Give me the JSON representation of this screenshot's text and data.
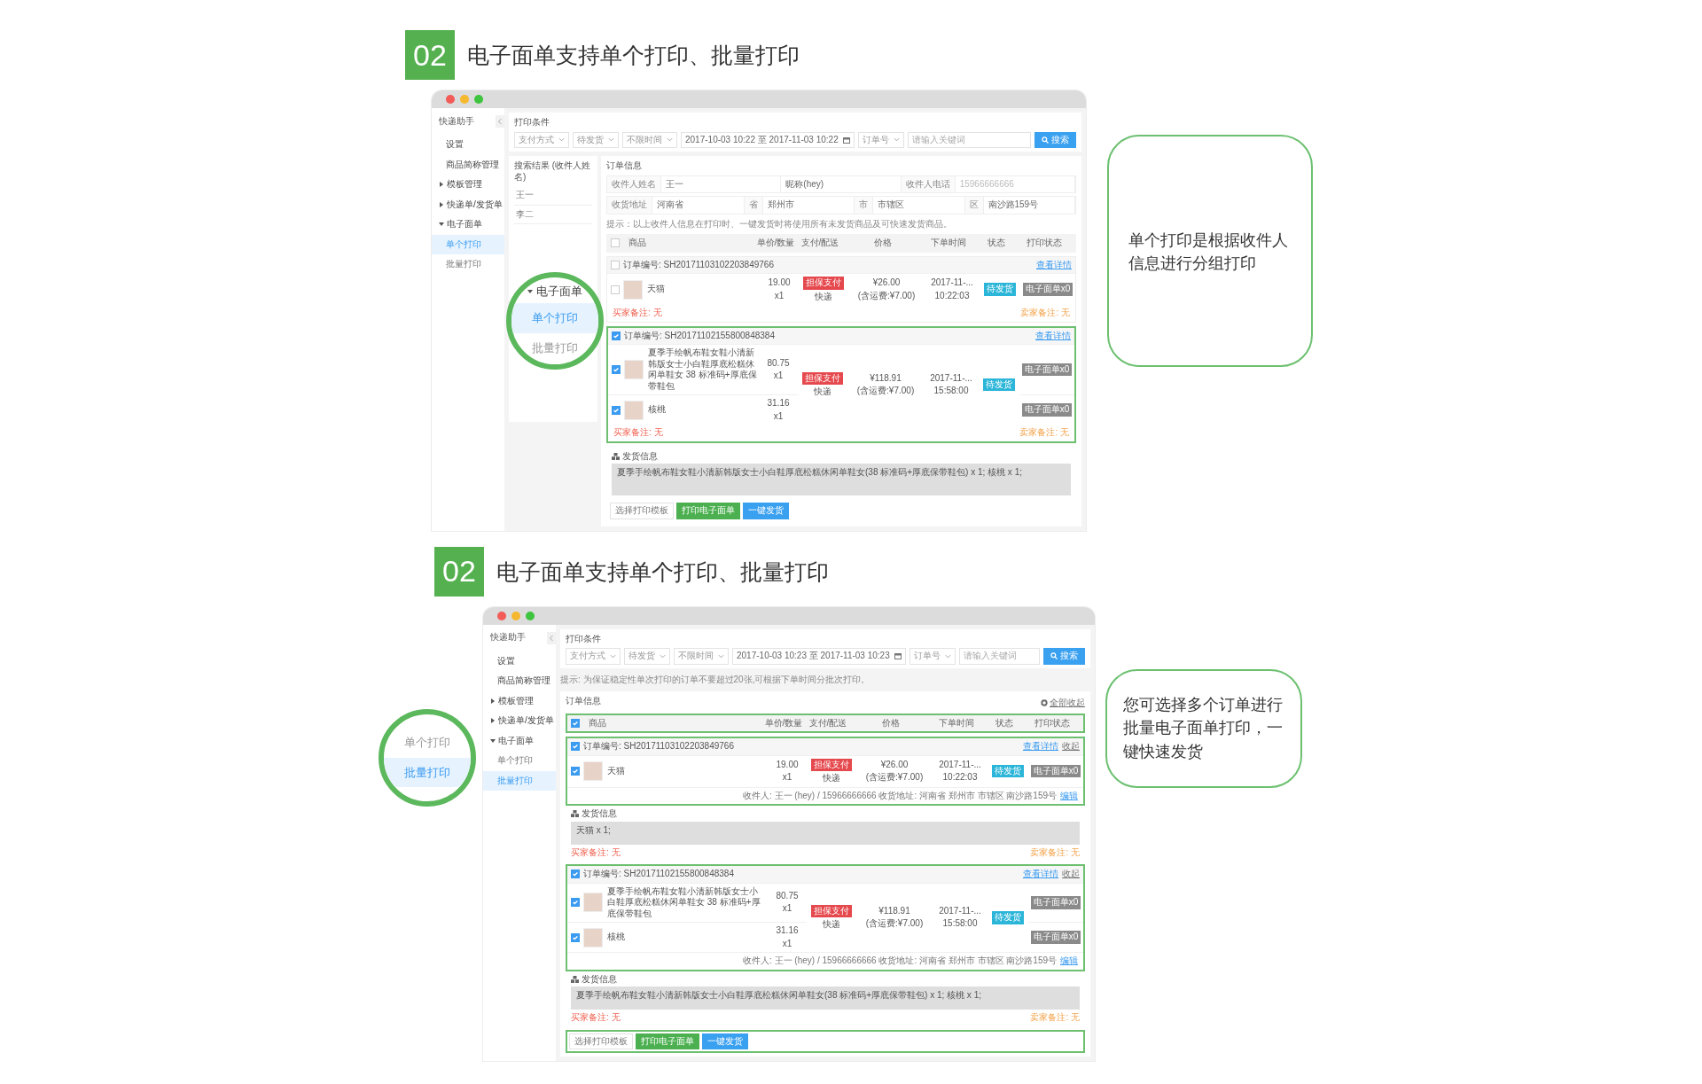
{
  "sections": [
    {
      "badge": "02",
      "title": "电子面单支持单个打印、批量打印",
      "callout": "单个打印是根据收件人信息进行分组打印",
      "zoom_circle": {
        "heading": "电子面单",
        "items": [
          {
            "label": "单个打印",
            "selected": true
          },
          {
            "label": "批量打印",
            "selected": false
          }
        ]
      },
      "app": {
        "sidebar": {
          "title": "快递助手",
          "items": [
            {
              "label": "设置",
              "kind": "link",
              "selected": false
            },
            {
              "label": "商品简称管理",
              "kind": "link",
              "selected": false
            },
            {
              "label": "模板管理",
              "kind": "group",
              "expanded": false
            },
            {
              "label": "快递单/发货单",
              "kind": "group",
              "expanded": false
            },
            {
              "label": "电子面单",
              "kind": "group",
              "expanded": true,
              "children": [
                {
                  "label": "单个打印",
                  "selected": true
                },
                {
                  "label": "批量打印",
                  "selected": false
                }
              ]
            }
          ]
        },
        "filter": {
          "title": "打印条件",
          "selects": [
            "支付方式",
            "待发货",
            "不限时间"
          ],
          "date_range": "2017-10-03 10:22 至 2017-11-03 10:22",
          "order_select": "订单号",
          "search_placeholder": "请输入关键词",
          "search_button": "搜索"
        },
        "results": {
          "title": "搜索结果 (收件人姓名)",
          "items": [
            "王一",
            "李二"
          ]
        },
        "order_info": {
          "title": "订单信息"
        },
        "recipient_form": [
          [
            {
              "kind": "label",
              "text": "收件人姓名"
            },
            {
              "kind": "value",
              "text": "王一"
            },
            {
              "kind": "value",
              "text": "昵称(hey)"
            },
            {
              "kind": "label",
              "text": "收件人电话"
            },
            {
              "kind": "hint",
              "text": "15966666666"
            }
          ],
          [
            {
              "kind": "label",
              "text": "收货地址"
            },
            {
              "kind": "value",
              "text": "河南省"
            },
            {
              "kind": "label",
              "text": "省"
            },
            {
              "kind": "value",
              "text": "郑州市"
            },
            {
              "kind": "label",
              "text": "市"
            },
            {
              "kind": "value",
              "text": "市辖区"
            },
            {
              "kind": "label",
              "text": "区"
            },
            {
              "kind": "value",
              "text": "南沙路159号"
            }
          ]
        ],
        "hint": "提示：以上收件人信息在打印时、一键发货时将使用所有未发货商品及可快速发货商品。",
        "table_header": {
          "checked": false,
          "highlighted": false,
          "columns": [
            "商品",
            "单价/数量",
            "支付/配送",
            "价格",
            "下单时间",
            "状态",
            "打印状态"
          ]
        },
        "orders": [
          {
            "checked": false,
            "highlighted": false,
            "number": "订单编号: SH20171103102203849766",
            "detail_link": "查看详情",
            "payment": "担保支付",
            "shipping": "快递",
            "total": "¥26.00",
            "freight": "(含运费:¥7.00)",
            "date": "2017-11-...",
            "time": "10:22:03",
            "status": "待发货",
            "buyer_note": "买家备注: 无",
            "seller_note": "卖家备注: 无",
            "items": [
              {
                "checked": false,
                "name": "天猫",
                "price": "19.00",
                "qty": "x1",
                "print_status": "电子面单x0"
              }
            ]
          },
          {
            "checked": true,
            "highlighted": true,
            "number": "订单编号: SH20171102155800848384",
            "detail_link": "查看详情",
            "payment": "担保支付",
            "shipping": "快递",
            "total": "¥118.91",
            "freight": "(含运费:¥7.00)",
            "date": "2017-11-...",
            "time": "15:58:00",
            "status": "待发货",
            "buyer_note": "买家备注: 无",
            "seller_note": "卖家备注: 无",
            "items": [
              {
                "checked": true,
                "name": "夏季手绘帆布鞋女鞋小清新韩版女士小白鞋厚底松糕休闲单鞋女 38 标准码+厚底保带鞋包",
                "price": "80.75",
                "qty": "x1",
                "print_status": "电子面单x0"
              },
              {
                "checked": true,
                "name": "核桃",
                "price": "31.16",
                "qty": "x1",
                "print_status": "电子面单x0"
              }
            ]
          }
        ],
        "shipping_info": {
          "title": "发货信息",
          "text": "夏季手绘帆布鞋女鞋小清新韩版女士小白鞋厚底松糕休闲单鞋女(38 标准码+厚底保带鞋包) x 1; 核桃 x 1;"
        },
        "actions": {
          "highlighted": false,
          "template_label": "选择打印模板",
          "print_button": "打印电子面单",
          "ship_button": "一键发货"
        }
      }
    },
    {
      "badge": "02",
      "title": "电子面单支持单个打印、批量打印",
      "callout": "您可选择多个订单进行批量电子面单打印，一键快速发货",
      "zoom_circle": {
        "items": [
          {
            "label": "单个打印",
            "selected": false
          },
          {
            "label": "批量打印",
            "selected": true
          }
        ]
      },
      "app": {
        "sidebar": {
          "title": "快递助手",
          "items": [
            {
              "label": "设置",
              "kind": "link",
              "selected": false
            },
            {
              "label": "商品简称管理",
              "kind": "link",
              "selected": false
            },
            {
              "label": "模板管理",
              "kind": "group",
              "expanded": false
            },
            {
              "label": "快递单/发货单",
              "kind": "group",
              "expanded": false
            },
            {
              "label": "电子面单",
              "kind": "group",
              "expanded": true,
              "children": [
                {
                  "label": "单个打印",
                  "selected": false
                },
                {
                  "label": "批量打印",
                  "selected": true
                }
              ]
            }
          ]
        },
        "filter": {
          "title": "打印条件",
          "selects": [
            "支付方式",
            "待发货",
            "不限时间"
          ],
          "date_range": "2017-10-03 10:23 至 2017-11-03 10:23",
          "order_select": "订单号",
          "search_placeholder": "请输入关键词",
          "search_button": "搜索"
        },
        "hint": "提示: 为保证稳定性单次打印的订单不要超过20张,可根据下单时间分批次打印。",
        "order_info": {
          "title": "订单信息",
          "collapse_all": "全部收起"
        },
        "table_header": {
          "checked": true,
          "highlighted": true,
          "columns": [
            "商品",
            "单价/数量",
            "支付/配送",
            "价格",
            "下单时间",
            "状态",
            "打印状态"
          ]
        },
        "orders": [
          {
            "checked": true,
            "highlighted": true,
            "number": "订单编号: SH20171103102203849766",
            "detail_link": "查看详情",
            "collapse_link": "收起",
            "payment": "担保支付",
            "shipping": "快递",
            "total": "¥26.00",
            "freight": "(含运费:¥7.00)",
            "date": "2017-11-...",
            "time": "10:22:03",
            "status": "待发货",
            "recipient": "收件人: 王一 (hey) / 15966666666 收货地址: 河南省 郑州市 市辖区 南沙路159号",
            "edit_link": "编辑",
            "buyer_note": "买家备注: 无",
            "seller_note": "卖家备注: 无",
            "items": [
              {
                "checked": true,
                "name": "天猫",
                "price": "19.00",
                "qty": "x1",
                "print_status": "电子面单x0"
              }
            ],
            "shipping_info": {
              "title": "发货信息",
              "text": "天猫 x 1;"
            }
          },
          {
            "checked": true,
            "highlighted": true,
            "number": "订单编号: SH20171102155800848384",
            "detail_link": "查看详情",
            "collapse_link": "收起",
            "payment": "担保支付",
            "shipping": "快递",
            "total": "¥118.91",
            "freight": "(含运费:¥7.00)",
            "date": "2017-11-...",
            "time": "15:58:00",
            "status": "待发货",
            "recipient": "收件人: 王一 (hey) / 15966666666 收货地址: 河南省 郑州市 市辖区 南沙路159号",
            "edit_link": "编辑",
            "buyer_note": "买家备注: 无",
            "seller_note": "卖家备注: 无",
            "items": [
              {
                "checked": true,
                "name": "夏季手绘帆布鞋女鞋小清新韩版女士小白鞋厚底松糕休闲单鞋女 38 标准码+厚底保带鞋包",
                "price": "80.75",
                "qty": "x1",
                "print_status": "电子面单x0"
              },
              {
                "checked": true,
                "name": "核桃",
                "price": "31.16",
                "qty": "x1",
                "print_status": "电子面单x0"
              }
            ],
            "shipping_info": {
              "title": "发货信息",
              "text": "夏季手绘帆布鞋女鞋小清新韩版女士小白鞋厚底松糕休闲单鞋女(38 标准码+厚底保带鞋包) x 1; 核桃 x 1;"
            }
          }
        ],
        "actions": {
          "highlighted": true,
          "template_label": "选择打印模板",
          "print_button": "打印电子面单",
          "ship_button": "一键发货"
        }
      }
    }
  ]
}
